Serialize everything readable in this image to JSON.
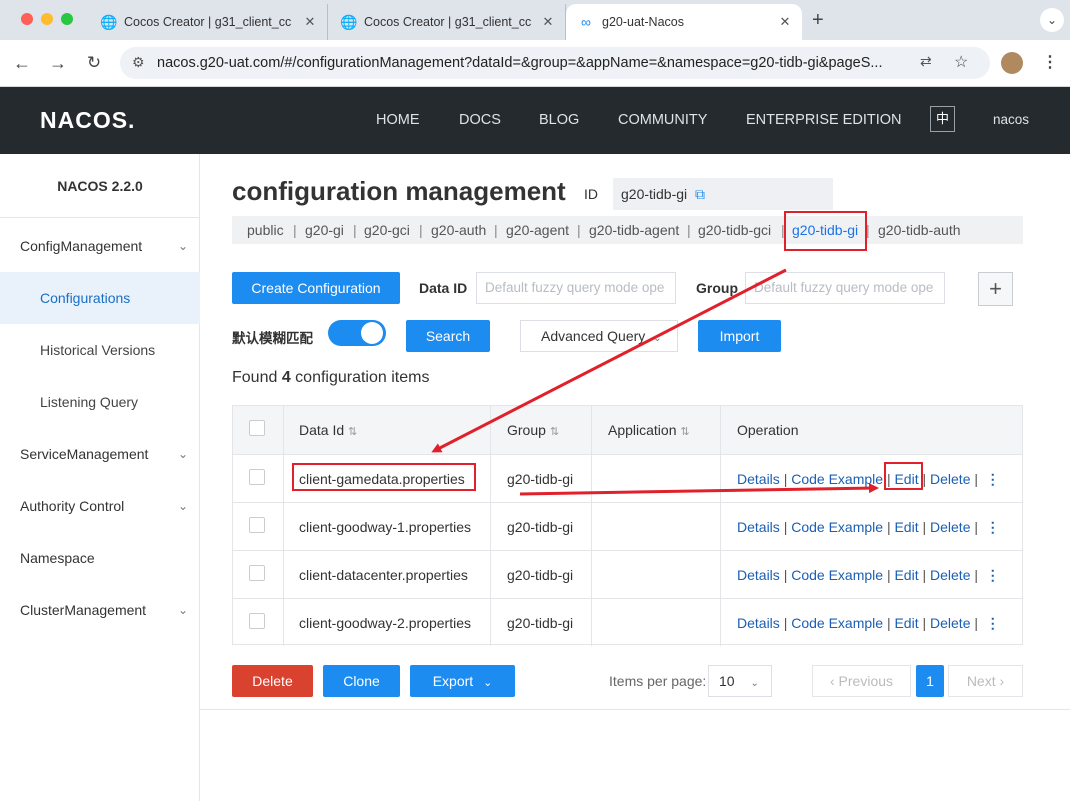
{
  "browser": {
    "tabs": [
      {
        "title": "Cocos Creator | g31_client_cc",
        "icon": "globe-icon"
      },
      {
        "title": "Cocos Creator | g31_client_cc",
        "icon": "globe-icon"
      },
      {
        "title": "g20-uat-Nacos",
        "icon": "infinity-icon",
        "active": true
      }
    ],
    "url": "nacos.g20-uat.com/#/configurationManagement?dataId=&group=&appName=&namespace=g20-tidb-gi&pageS..."
  },
  "header": {
    "logo": "NACOS.",
    "nav": [
      "HOME",
      "DOCS",
      "BLOG",
      "COMMUNITY",
      "ENTERPRISE EDITION"
    ],
    "lang": "中",
    "user": "nacos"
  },
  "sidebar": {
    "version": "NACOS 2.2.0",
    "items": [
      {
        "label": "ConfigManagement",
        "type": "top",
        "chevron": true
      },
      {
        "label": "Configurations",
        "type": "sub",
        "selected": true
      },
      {
        "label": "Historical Versions",
        "type": "sub"
      },
      {
        "label": "Listening Query",
        "type": "sub"
      },
      {
        "label": "ServiceManagement",
        "type": "top",
        "chevron": true
      },
      {
        "label": "Authority Control",
        "type": "top",
        "chevron": true
      },
      {
        "label": "Namespace",
        "type": "top"
      },
      {
        "label": "ClusterManagement",
        "type": "top",
        "chevron": true
      }
    ]
  },
  "main": {
    "title": "configuration management",
    "id_label": "ID",
    "id_value": "g20-tidb-gi",
    "namespaces": [
      "public",
      "g20-gi",
      "g20-gci",
      "g20-auth",
      "g20-agent",
      "g20-tidb-agent",
      "g20-tidb-gci",
      "g20-tidb-gi",
      "g20-tidb-auth"
    ],
    "current_namespace": "g20-tidb-gi",
    "create_button": "Create Configuration",
    "dataid_label": "Data ID",
    "dataid_placeholder": "Default fuzzy query mode ope",
    "group_label": "Group",
    "group_placeholder": "Default fuzzy query mode ope",
    "fuzzy_label": "默认模糊匹配",
    "search_button": "Search",
    "advanced_query": "Advanced Query",
    "import_button": "Import",
    "found_prefix": "Found ",
    "found_count": "4",
    "found_suffix": " configuration items",
    "columns": [
      "Data Id",
      "Group",
      "Application",
      "Operation"
    ],
    "rows": [
      {
        "data_id": "client-gamedata.properties",
        "group": "g20-tidb-gi",
        "application": ""
      },
      {
        "data_id": "client-goodway-1.properties",
        "group": "g20-tidb-gi",
        "application": ""
      },
      {
        "data_id": "client-datacenter.properties",
        "group": "g20-tidb-gi",
        "application": ""
      },
      {
        "data_id": "client-goodway-2.properties",
        "group": "g20-tidb-gi",
        "application": ""
      }
    ],
    "operations": [
      "Details",
      "Code Example",
      "Edit",
      "Delete"
    ],
    "footer": {
      "delete": "Delete",
      "clone": "Clone",
      "export": "Export",
      "items_per_page_label": "Items per page:",
      "items_per_page": "10",
      "previous": "Previous",
      "page": "1",
      "next": "Next"
    }
  },
  "colors": {
    "accent": "#1c8cf0",
    "danger": "#d9422f",
    "header_bg": "#252a2f",
    "annotation": "#e0202a"
  }
}
